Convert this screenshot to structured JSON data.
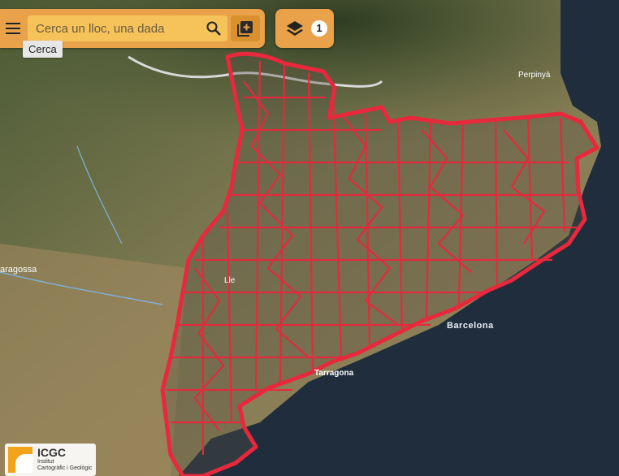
{
  "search": {
    "placeholder": "Cerca un lloc, una dada",
    "tooltip": "Cerca"
  },
  "layers": {
    "count": "1"
  },
  "map": {
    "labels": {
      "perpinya": "Perpinyà",
      "zaragoza": "aragossa",
      "lleida": "Lle",
      "barcelona": "Barcelona",
      "tarragona": "Tarragona"
    },
    "overlay_color": "#e8283c",
    "sea_color": "#1f2d3d"
  },
  "logo": {
    "name": "ICGC",
    "subtitle_line1": "Institut",
    "subtitle_line2": "Cartogràfic i Geològic"
  },
  "colors": {
    "toolbar": "#e9a24a",
    "search_field": "#f6c35a"
  },
  "icons": {
    "menu": "menu-icon",
    "search": "search-icon",
    "add": "add-box-icon",
    "layers": "layers-icon"
  }
}
